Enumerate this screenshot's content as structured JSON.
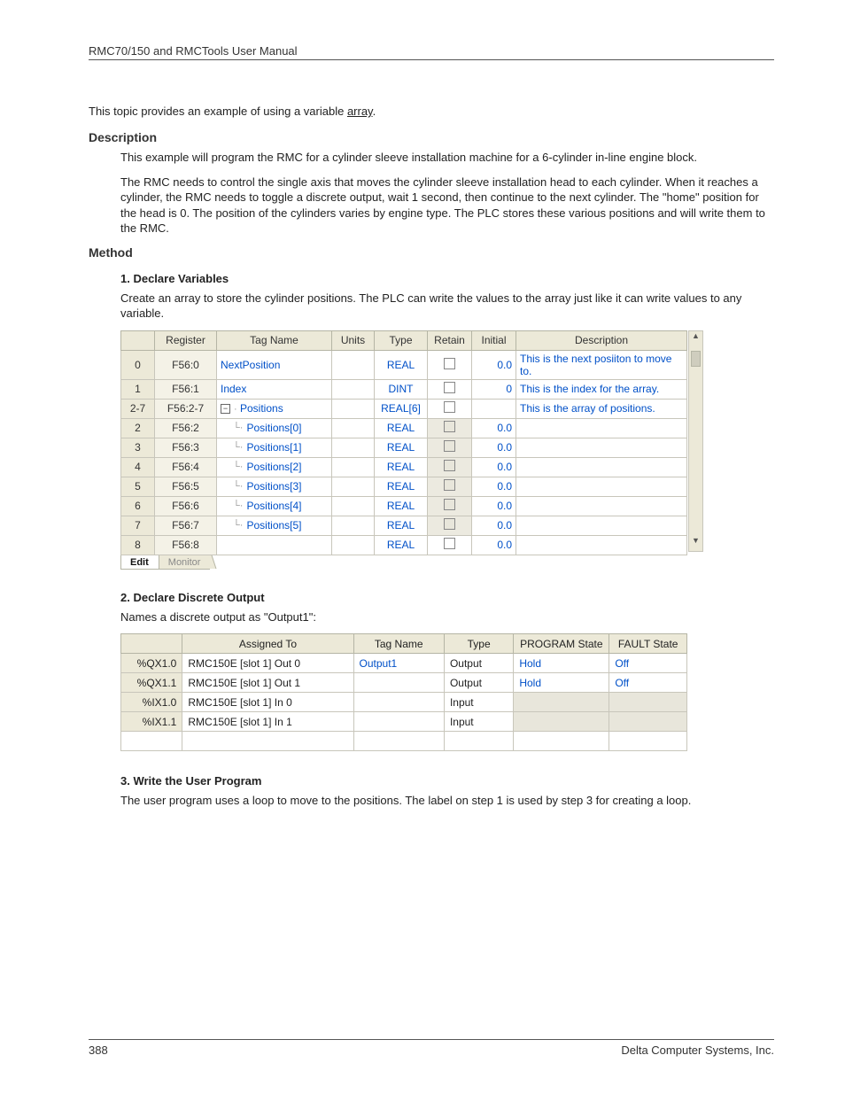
{
  "header": {
    "title": "RMC70/150 and RMCTools User Manual"
  },
  "intro": {
    "prefix": "This topic provides an example of using a variable ",
    "link": "array",
    "suffix": "."
  },
  "sections": {
    "description_title": "Description",
    "description_p1": "This example will program the RMC for a cylinder sleeve installation machine for a 6-cylinder in-line engine block.",
    "description_p2": "The RMC needs to control the single axis that moves the cylinder sleeve installation head to each cylinder. When it reaches a cylinder, the RMC needs to toggle a discrete output, wait 1 second, then continue to the next cylinder. The \"home\" position for the head is 0. The position of the cylinders varies by engine type. The PLC stores these various positions and will write them to the RMC.",
    "method_title": "Method",
    "step1_title": "1. Declare Variables",
    "step1_text": "Create an array to store the cylinder positions. The PLC can write the values to the array just like it can write values to any variable.",
    "step2_title": "2. Declare Discrete Output",
    "step2_text": "Names a discrete output as \"Output1\":",
    "step3_title": "3. Write the User Program",
    "step3_text": "The user program uses a loop to move to the positions. The label on step 1 is used by step 3 for creating a loop."
  },
  "vt_headers": {
    "register": "Register",
    "tag": "Tag Name",
    "units": "Units",
    "type": "Type",
    "retain": "Retain",
    "initial": "Initial",
    "desc": "Description"
  },
  "vt_rows": [
    {
      "idx": "0",
      "reg": "F56:0",
      "tag": "NextPosition",
      "type": "REAL",
      "initial": "0.0",
      "desc": "This is the next posiiton to move to.",
      "kind": "top"
    },
    {
      "idx": "1",
      "reg": "F56:1",
      "tag": "Index",
      "type": "DINT",
      "initial": "0",
      "desc": "This is the index for the array.",
      "kind": "top"
    },
    {
      "idx": "2-7",
      "reg": "F56:2-7",
      "tag": "Positions",
      "type": "REAL[6]",
      "initial": "",
      "desc": "This is the array of positions.",
      "kind": "array-head"
    },
    {
      "idx": "2",
      "reg": "F56:2",
      "tag": "Positions[0]",
      "type": "REAL",
      "initial": "0.0",
      "desc": "",
      "kind": "array-item"
    },
    {
      "idx": "3",
      "reg": "F56:3",
      "tag": "Positions[1]",
      "type": "REAL",
      "initial": "0.0",
      "desc": "",
      "kind": "array-item"
    },
    {
      "idx": "4",
      "reg": "F56:4",
      "tag": "Positions[2]",
      "type": "REAL",
      "initial": "0.0",
      "desc": "",
      "kind": "array-item"
    },
    {
      "idx": "5",
      "reg": "F56:5",
      "tag": "Positions[3]",
      "type": "REAL",
      "initial": "0.0",
      "desc": "",
      "kind": "array-item"
    },
    {
      "idx": "6",
      "reg": "F56:6",
      "tag": "Positions[4]",
      "type": "REAL",
      "initial": "0.0",
      "desc": "",
      "kind": "array-item"
    },
    {
      "idx": "7",
      "reg": "F56:7",
      "tag": "Positions[5]",
      "type": "REAL",
      "initial": "0.0",
      "desc": "",
      "kind": "array-item"
    },
    {
      "idx": "8",
      "reg": "F56:8",
      "tag": "",
      "type": "REAL",
      "initial": "0.0",
      "desc": "",
      "kind": "blank"
    }
  ],
  "tabs": {
    "edit": "Edit",
    "monitor": "Monitor"
  },
  "io_headers": {
    "assigned": "Assigned To",
    "tag": "Tag Name",
    "type": "Type",
    "pstate": "PROGRAM State",
    "fstate": "FAULT State"
  },
  "io_rows": [
    {
      "addr": "%QX1.0",
      "assigned": "RMC150E [slot 1] Out 0",
      "tag": "Output1",
      "type": "Output",
      "pstate": "Hold",
      "fstate": "Off",
      "grey": false,
      "tagblue": true
    },
    {
      "addr": "%QX1.1",
      "assigned": "RMC150E [slot 1] Out 1",
      "tag": "",
      "type": "Output",
      "pstate": "Hold",
      "fstate": "Off",
      "grey": false,
      "tagblue": false
    },
    {
      "addr": "%IX1.0",
      "assigned": "RMC150E [slot 1] In 0",
      "tag": "",
      "type": "Input",
      "pstate": "",
      "fstate": "",
      "grey": true,
      "tagblue": false
    },
    {
      "addr": "%IX1.1",
      "assigned": "RMC150E [slot 1] In 1",
      "tag": "",
      "type": "Input",
      "pstate": "",
      "fstate": "",
      "grey": true,
      "tagblue": false
    }
  ],
  "footer": {
    "page": "388",
    "company": "Delta Computer Systems, Inc."
  }
}
